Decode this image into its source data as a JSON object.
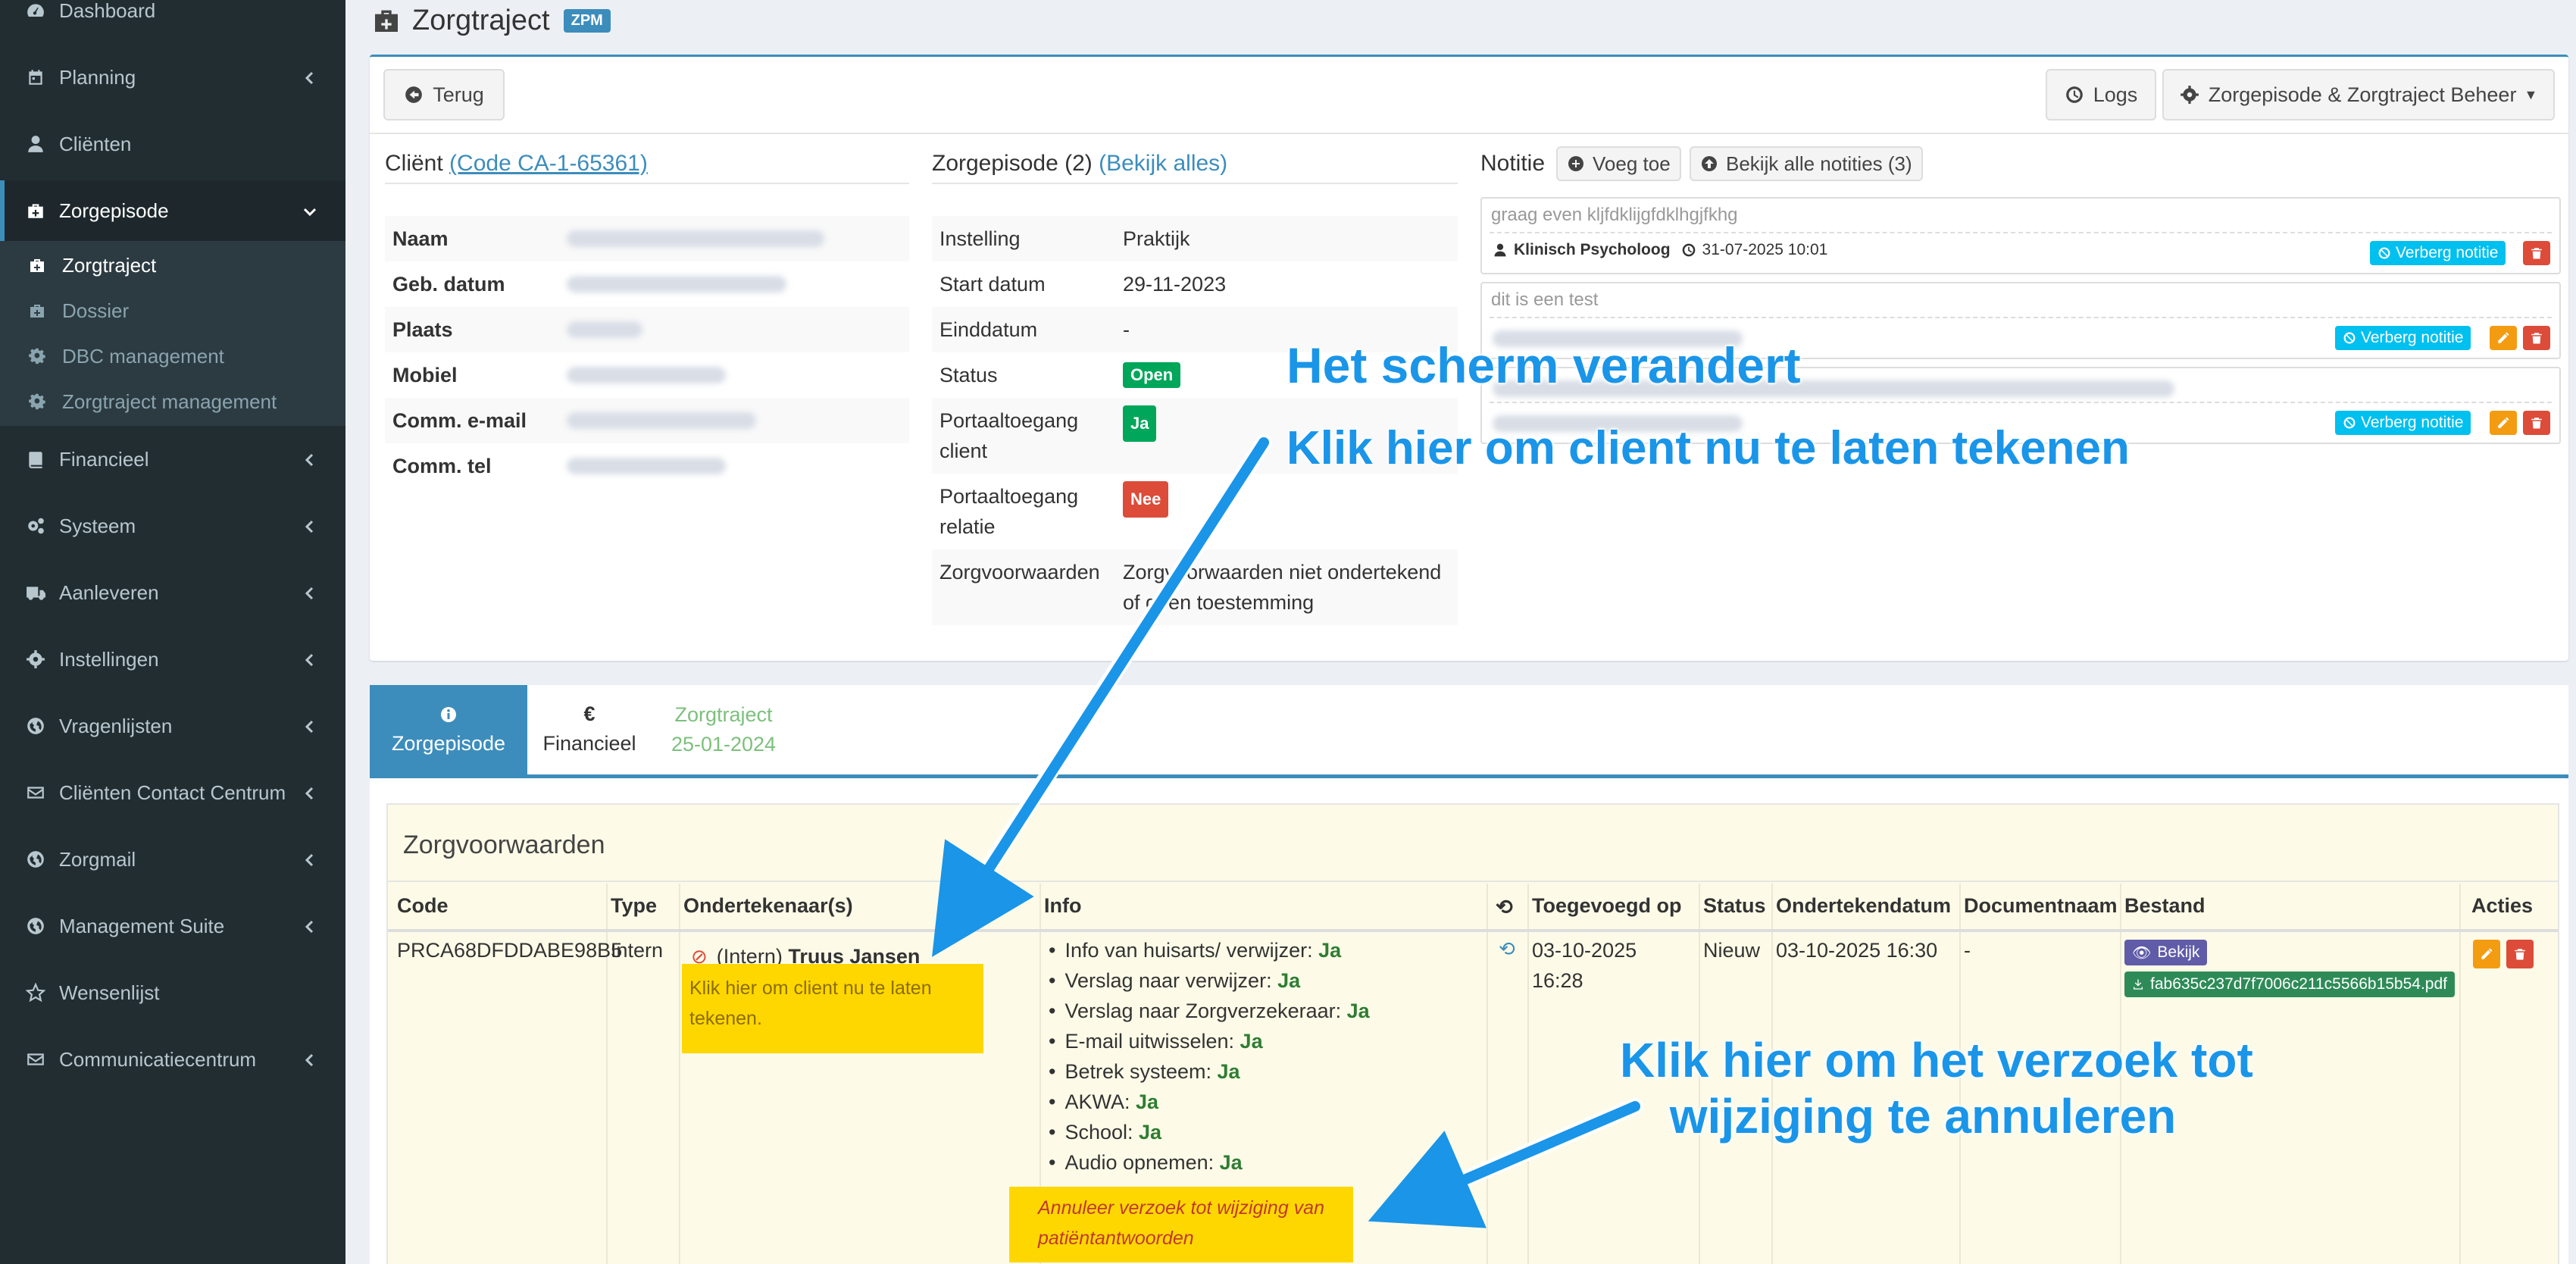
{
  "sidebar": {
    "items": [
      {
        "label": "Dashboard",
        "icon": "dashboard-icon"
      },
      {
        "label": "Planning",
        "icon": "calendar-icon"
      },
      {
        "label": "Cliënten",
        "icon": "user-icon"
      },
      {
        "label": "Zorgepisode",
        "icon": "medkit-icon"
      },
      {
        "label": "Financieel",
        "icon": "book-icon"
      },
      {
        "label": "Systeem",
        "icon": "gears-icon"
      },
      {
        "label": "Aanleveren",
        "icon": "truck-icon"
      },
      {
        "label": "Instellingen",
        "icon": "gear-icon"
      },
      {
        "label": "Vragenlijsten",
        "icon": "globe-icon"
      },
      {
        "label": "Cliënten Contact Centrum",
        "icon": "envelope-icon"
      },
      {
        "label": "Zorgmail",
        "icon": "globe-icon"
      },
      {
        "label": "Management Suite",
        "icon": "globe-icon"
      },
      {
        "label": "Wensenlijst",
        "icon": "star-icon"
      },
      {
        "label": "Communicatiecentrum",
        "icon": "envelope-icon"
      }
    ],
    "subitems": [
      {
        "label": "Zorgtraject",
        "icon": "medkit-icon"
      },
      {
        "label": "Dossier",
        "icon": "medkit-icon"
      },
      {
        "label": "DBC management",
        "icon": "gear-icon"
      },
      {
        "label": "Zorgtraject management",
        "icon": "gear-icon"
      }
    ]
  },
  "header": {
    "title": "Zorgtraject",
    "badge": "ZPM"
  },
  "toolbar": {
    "back": "Terug",
    "logs": "Logs",
    "beheer": "Zorgepisode & Zorgtraject Beheer"
  },
  "client": {
    "title": "Cliënt",
    "code_link": "(Code CA-1-65361)",
    "fields": [
      "Naam",
      "Geb. datum",
      "Plaats",
      "Mobiel",
      "Comm. e-mail",
      "Comm. tel"
    ]
  },
  "episode": {
    "title": "Zorgepisode (2)",
    "view_all": "(Bekijk alles)",
    "rows": [
      {
        "key": "Instelling",
        "value": "Praktijk"
      },
      {
        "key": "Start datum",
        "value": "29-11-2023"
      },
      {
        "key": "Einddatum",
        "value": "-"
      },
      {
        "key": "Status",
        "value": "Open"
      },
      {
        "key": "Portaaltoegang client",
        "value": "Ja"
      },
      {
        "key": "Portaaltoegang relatie",
        "value": "Nee"
      },
      {
        "key": "Zorgvoorwaarden",
        "value": "Zorgvoorwaarden niet ondertekend of geen toestemming"
      }
    ]
  },
  "notes": {
    "title": "Notitie",
    "add": "Voeg toe",
    "view_all": "Bekijk alle notities (3)",
    "items": [
      {
        "text": "graag even kljfdklijgfdklhgjfkhg",
        "author": "Klinisch Psycholoog",
        "date": "31-07-2025 10:01",
        "hide": "Verberg notitie"
      },
      {
        "text": "dit is een test",
        "hide": "Verberg notitie"
      },
      {
        "hide": "Verberg notitie"
      }
    ]
  },
  "tabs": [
    {
      "label": "Zorgepisode",
      "icon": "info-icon"
    },
    {
      "label": "Financieel",
      "icon": "€"
    },
    {
      "label": "Zorgtraject",
      "sub": "25-01-2024"
    }
  ],
  "zv": {
    "title": "Zorgvoorwaarden",
    "columns": [
      "Code",
      "Type",
      "Ondertekenaar(s)",
      "Info",
      "Toegevoegd op",
      "Status",
      "Ondertekendatum",
      "Documentnaam",
      "Bestand",
      "Acties"
    ],
    "row": {
      "code": "PRCA68DFDDABE98B5",
      "type": "Intern",
      "signer_prefix": "(Intern)",
      "signer": "Truus Jansen",
      "sign_link": "Klik hier om client nu te laten tekenen.",
      "info": [
        {
          "k": "Info van huisarts/ verwijzer:",
          "v": "Ja"
        },
        {
          "k": "Verslag naar verwijzer:",
          "v": "Ja"
        },
        {
          "k": "Verslag naar Zorgverzekeraar:",
          "v": "Ja"
        },
        {
          "k": "E-mail uitwisselen:",
          "v": "Ja"
        },
        {
          "k": "Betrek systeem:",
          "v": "Ja"
        },
        {
          "k": "AKWA:",
          "v": "Ja"
        },
        {
          "k": "School:",
          "v": "Ja"
        },
        {
          "k": "Audio opnemen:",
          "v": "Ja"
        }
      ],
      "cancel_link": "Annuleer verzoek tot wijziging van patiëntantwoorden",
      "added": "03-10-2025 16:28",
      "status": "Nieuw",
      "signed": "03-10-2025 16:30",
      "docname": "-",
      "view": "Bekijk",
      "file": "fab635c237d7f7006c211c5566b15b54.pdf"
    }
  },
  "annotations": {
    "screen": "Het scherm verandert",
    "sign": "Klik hier om client nu te laten tekenen",
    "cancel_line1": "Klik hier om het verzoek tot",
    "cancel_line2": "wijziging te annuleren"
  },
  "colors": {
    "primary": "#3c8dbc",
    "sidebar": "#222d32",
    "success": "#00a65a",
    "danger": "#dd4b39",
    "info": "#00c0ef",
    "warning": "#f39c12",
    "annotation": "#1a95e8",
    "highlight": "#ffd700"
  }
}
